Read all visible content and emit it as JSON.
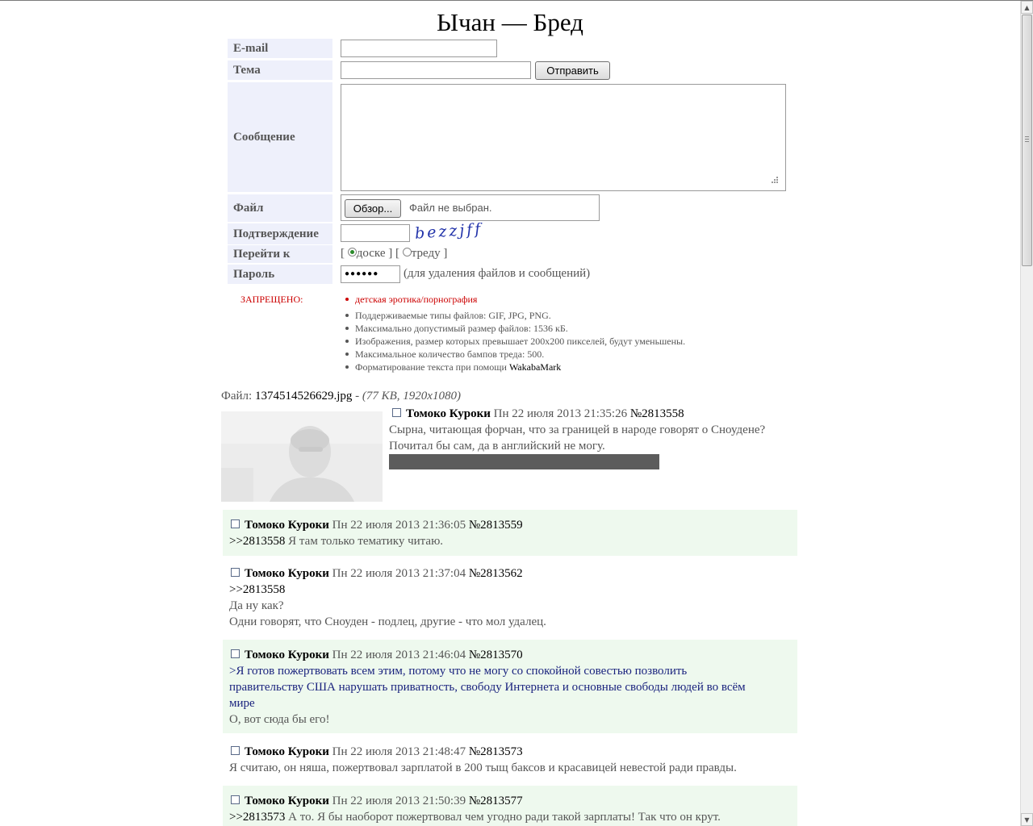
{
  "board_title": "Ычан — Бред",
  "form": {
    "email_label": "E-mail",
    "subject_label": "Тема",
    "submit_label": "Отправить",
    "message_label": "Сообщение",
    "file_label": "Файл",
    "browse_label": "Обзор...",
    "no_file_text": "Файл не выбран.",
    "captcha_label": "Подтверждение",
    "captcha_text": "bezzjff",
    "goto_label": "Перейти к",
    "goto_open": "[",
    "goto_board": "доске",
    "goto_sep": "] [",
    "goto_thread": "треду",
    "goto_close": "]",
    "password_label": "Пароль",
    "password_value": "●●●●●●",
    "password_hint": "(для удаления файлов и сообщений)"
  },
  "rules": {
    "forbidden_label": "ЗАПРЕЩЕНО:",
    "forbidden_item": "детская эротика/порнография",
    "items": [
      "Поддерживаемые типы файлов: GIF, JPG, PNG.",
      "Максимально допустимый размер файлов: 1536 кБ.",
      "Изображения, размер которых превышает 200x200 пикселей, будут уменьшены.",
      "Максимальное количество бампов треда: 500."
    ],
    "format_text": "Форматирование текста при помощи",
    "format_link": "WakabaMark"
  },
  "op": {
    "file_prefix": "Файл:",
    "file_name": "1374514526629.jpg",
    "file_sep": "-",
    "file_meta": "(77 KB, 1920x1080)",
    "name": "Томоко Куроки",
    "date": "Пн 22 июля 2013 21:35:26",
    "number": "№2813558",
    "text1": "Сырна, читающая форчан, что за границей в народе говорят о Сноудене?",
    "text2": "Почитал бы сам, да в английский не могу."
  },
  "replies": [
    {
      "name": "Томоко Куроки",
      "date": "Пн 22 июля 2013 21:36:05",
      "number": "№2813559",
      "quote": ">>2813558",
      "text": "Я там только тематику читаю."
    },
    {
      "name": "Томоко Куроки",
      "date": "Пн 22 июля 2013 21:37:04",
      "number": "№2813562",
      "quote": ">>2813558",
      "line1": "Да ну как?",
      "line2": "Одни говорят, что Сноуден - подлец, другие - что мол удалец."
    },
    {
      "name": "Томоко Куроки",
      "date": "Пн 22 июля 2013 21:46:04",
      "number": "№2813570",
      "greentext1": ">Я готов пожертвовать всем этим, потому что не могу со спокойной совестью позволить",
      "greentext2": "правительству США нарушать приватность, свободу Интернета и основные свободы людей во всём",
      "greentext3": "мире",
      "text": "О, вот сюда бы его!"
    },
    {
      "name": "Томоко Куроки",
      "date": "Пн 22 июля 2013 21:48:47",
      "number": "№2813573",
      "text": "Я считаю, он няша, пожертвовал зарплатой в 200 тыщ баксов и красавицей невестой ради правды."
    },
    {
      "name": "Томоко Куроки",
      "date": "Пн 22 июля 2013 21:50:39",
      "number": "№2813577",
      "quote": ">>2813573",
      "text": "А то. Я бы наоборот пожертвовал чем угодно ради такой зарплаты! Так что он крут."
    }
  ]
}
